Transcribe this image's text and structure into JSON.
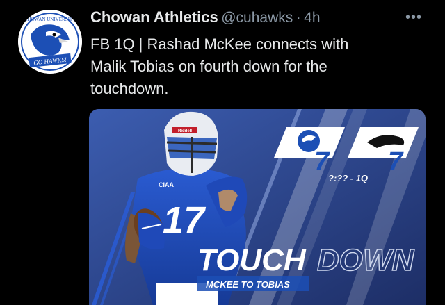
{
  "tweet": {
    "author_name": "Chowan Athletics",
    "handle": "@cuhawks",
    "separator": "·",
    "time": "4h",
    "text_lines": [
      "FB 1Q | Rashad McKee connects with",
      "Malik Tobias on fourth down for the",
      "touchdown."
    ]
  },
  "avatar": {
    "top_text": "CHOWAN UNIVERSITY",
    "bottom_text": "GO HAWKS!"
  },
  "graphic": {
    "home_score": "7",
    "away_score": "7",
    "clock": "?:?? - 1Q",
    "headline_solid": "TOUCH",
    "headline_outline": "DOWN",
    "caption": "MCKEE TO TOBIAS",
    "jersey_number": "17",
    "helmet_brand": "Riddell",
    "chest_text": "CIAA"
  },
  "colors": {
    "background": "#000000",
    "name": "#e7e9ea",
    "muted": "#8b98a5",
    "chowan_blue": "#1c4fb5"
  }
}
